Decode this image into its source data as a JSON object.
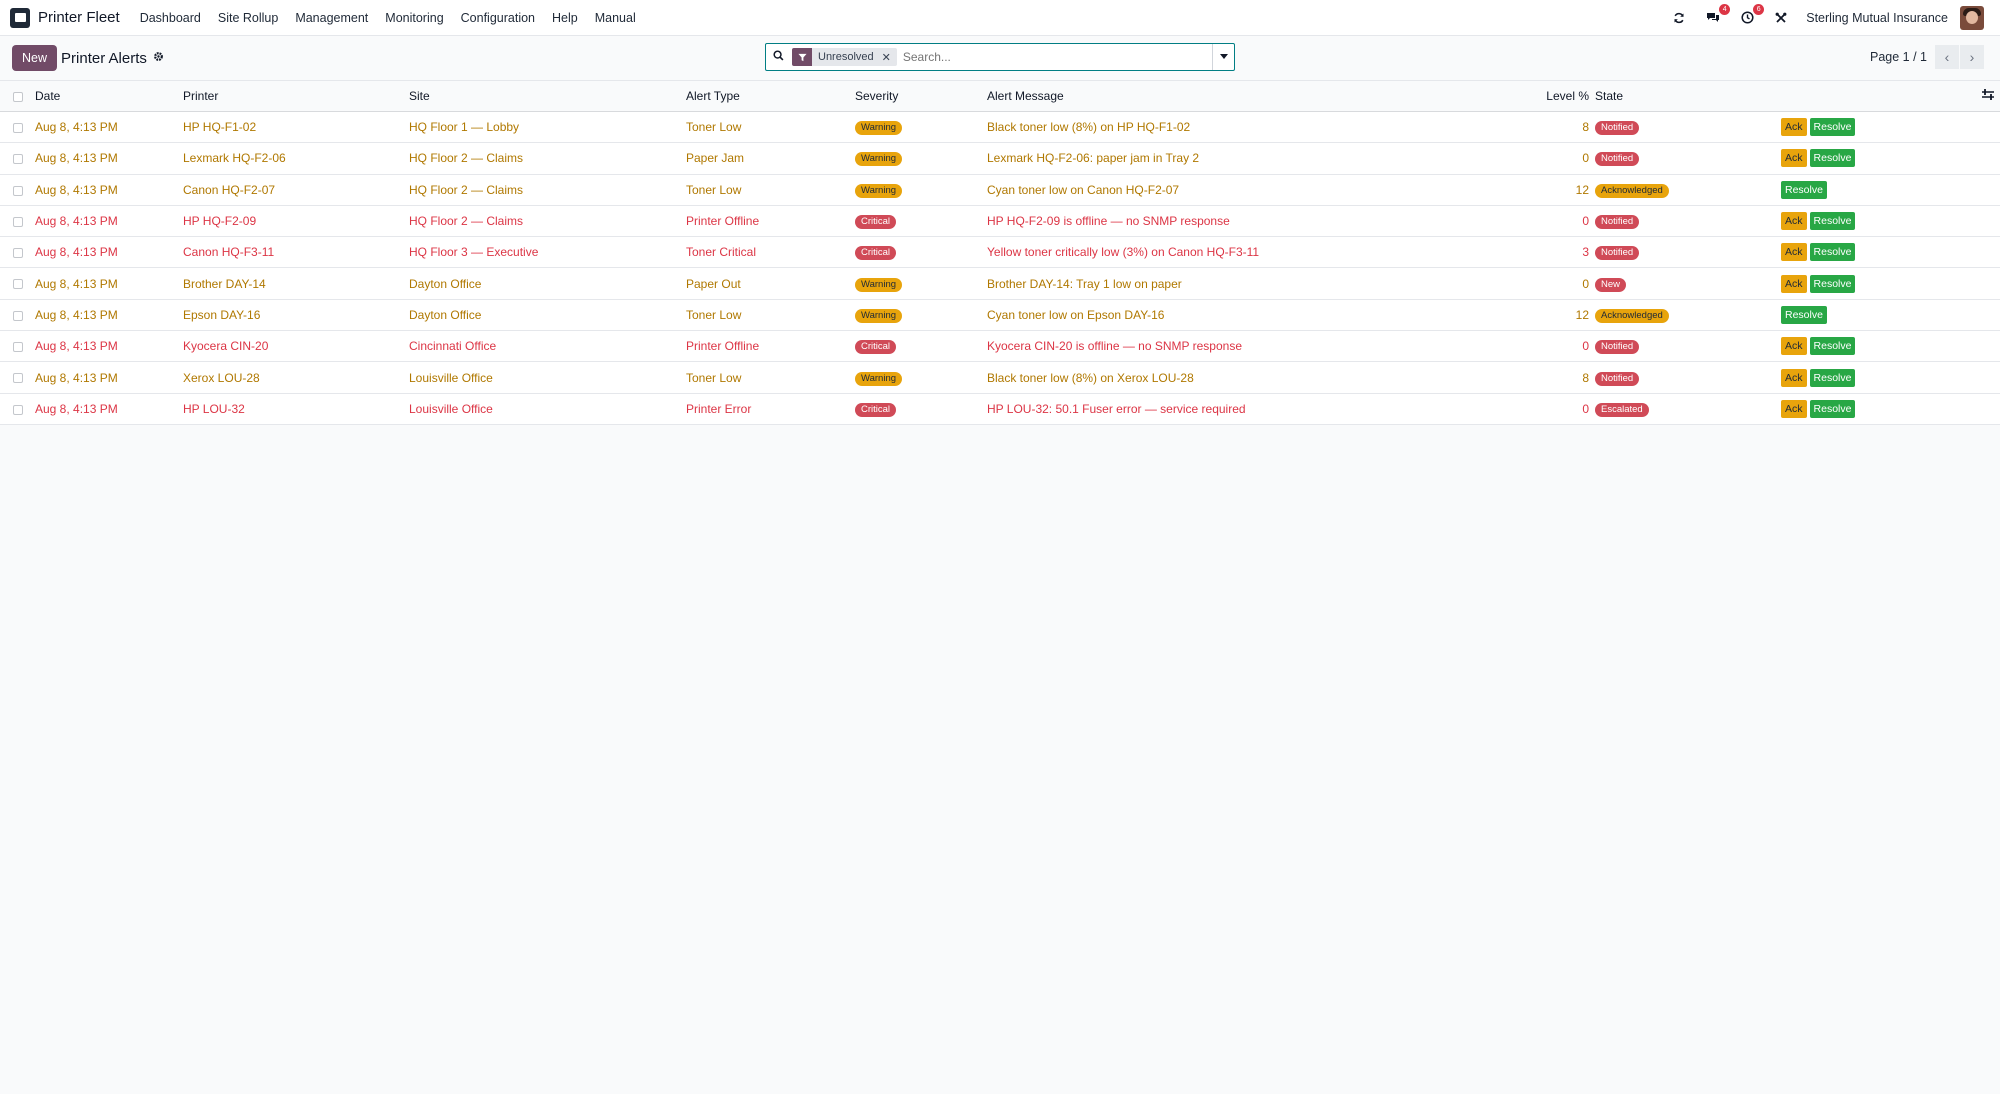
{
  "navbar": {
    "app_title": "Printer Fleet",
    "menu": [
      "Dashboard",
      "Site Rollup",
      "Management",
      "Monitoring",
      "Configuration",
      "Help",
      "Manual"
    ],
    "messages_count": "4",
    "activities_count": "6",
    "company": "Sterling Mutual Insurance"
  },
  "control": {
    "new_label": "New",
    "title": "Printer Alerts",
    "facet_label": "Unresolved",
    "search_placeholder": "Search...",
    "pager": "Page 1 / 1"
  },
  "columns": [
    "Date",
    "Printer",
    "Site",
    "Alert Type",
    "Severity",
    "Alert Message",
    "Level %",
    "State"
  ],
  "rows": [
    {
      "date": "Aug 8, 4:13 PM",
      "printer": "HP HQ-F1-02",
      "site": "HQ Floor 1 — Lobby",
      "type": "Toner Low",
      "severity": "Warning",
      "message": "Black toner low (8%) on HP HQ-F1-02",
      "level": "8",
      "state": "Notified",
      "ack": "Ack",
      "resolve": "Resolve"
    },
    {
      "date": "Aug 8, 4:13 PM",
      "printer": "Lexmark HQ-F2-06",
      "site": "HQ Floor 2 — Claims",
      "type": "Paper Jam",
      "severity": "Warning",
      "message": "Lexmark HQ-F2-06: paper jam in Tray 2",
      "level": "0",
      "state": "Notified",
      "ack": "Ack",
      "resolve": "Resolve"
    },
    {
      "date": "Aug 8, 4:13 PM",
      "printer": "Canon HQ-F2-07",
      "site": "HQ Floor 2 — Claims",
      "type": "Toner Low",
      "severity": "Warning",
      "message": "Cyan toner low on Canon HQ-F2-07",
      "level": "12",
      "state": "Acknowledged",
      "ack": "",
      "resolve": "Resolve"
    },
    {
      "date": "Aug 8, 4:13 PM",
      "printer": "HP HQ-F2-09",
      "site": "HQ Floor 2 — Claims",
      "type": "Printer Offline",
      "severity": "Critical",
      "message": "HP HQ-F2-09 is offline — no SNMP response",
      "level": "0",
      "state": "Notified",
      "ack": "Ack",
      "resolve": "Resolve"
    },
    {
      "date": "Aug 8, 4:13 PM",
      "printer": "Canon HQ-F3-11",
      "site": "HQ Floor 3 — Executive",
      "type": "Toner Critical",
      "severity": "Critical",
      "message": "Yellow toner critically low (3%) on Canon HQ-F3-11",
      "level": "3",
      "state": "Notified",
      "ack": "Ack",
      "resolve": "Resolve"
    },
    {
      "date": "Aug 8, 4:13 PM",
      "printer": "Brother DAY-14",
      "site": "Dayton Office",
      "type": "Paper Out",
      "severity": "Warning",
      "message": "Brother DAY-14: Tray 1 low on paper",
      "level": "0",
      "state": "New",
      "ack": "Ack",
      "resolve": "Resolve"
    },
    {
      "date": "Aug 8, 4:13 PM",
      "printer": "Epson DAY-16",
      "site": "Dayton Office",
      "type": "Toner Low",
      "severity": "Warning",
      "message": "Cyan toner low on Epson DAY-16",
      "level": "12",
      "state": "Acknowledged",
      "ack": "",
      "resolve": "Resolve"
    },
    {
      "date": "Aug 8, 4:13 PM",
      "printer": "Kyocera CIN-20",
      "site": "Cincinnati Office",
      "type": "Printer Offline",
      "severity": "Critical",
      "message": "Kyocera CIN-20 is offline — no SNMP response",
      "level": "0",
      "state": "Notified",
      "ack": "Ack",
      "resolve": "Resolve"
    },
    {
      "date": "Aug 8, 4:13 PM",
      "printer": "Xerox LOU-28",
      "site": "Louisville Office",
      "type": "Toner Low",
      "severity": "Warning",
      "message": "Black toner low (8%) on Xerox LOU-28",
      "level": "8",
      "state": "Notified",
      "ack": "Ack",
      "resolve": "Resolve"
    },
    {
      "date": "Aug 8, 4:13 PM",
      "printer": "HP LOU-32",
      "site": "Louisville Office",
      "type": "Printer Error",
      "severity": "Critical",
      "message": "HP LOU-32: 50.1 Fuser error — service required",
      "level": "0",
      "state": "Escalated",
      "ack": "Ack",
      "resolve": "Resolve"
    }
  ],
  "icons": {
    "logo": "printer-app-icon",
    "refresh": "refresh-icon",
    "messages": "chat-icon",
    "activities": "clock-icon",
    "debug": "tools-icon",
    "search": "search-icon",
    "filter": "filter-icon",
    "optional_columns": "sliders-icon"
  },
  "colors": {
    "brand": "#714b67",
    "warning": "#e8a40c",
    "critical": "#d04a57",
    "resolve": "#28a745",
    "row_warning_text": "#b07800",
    "row_critical_text": "#dc3545"
  }
}
